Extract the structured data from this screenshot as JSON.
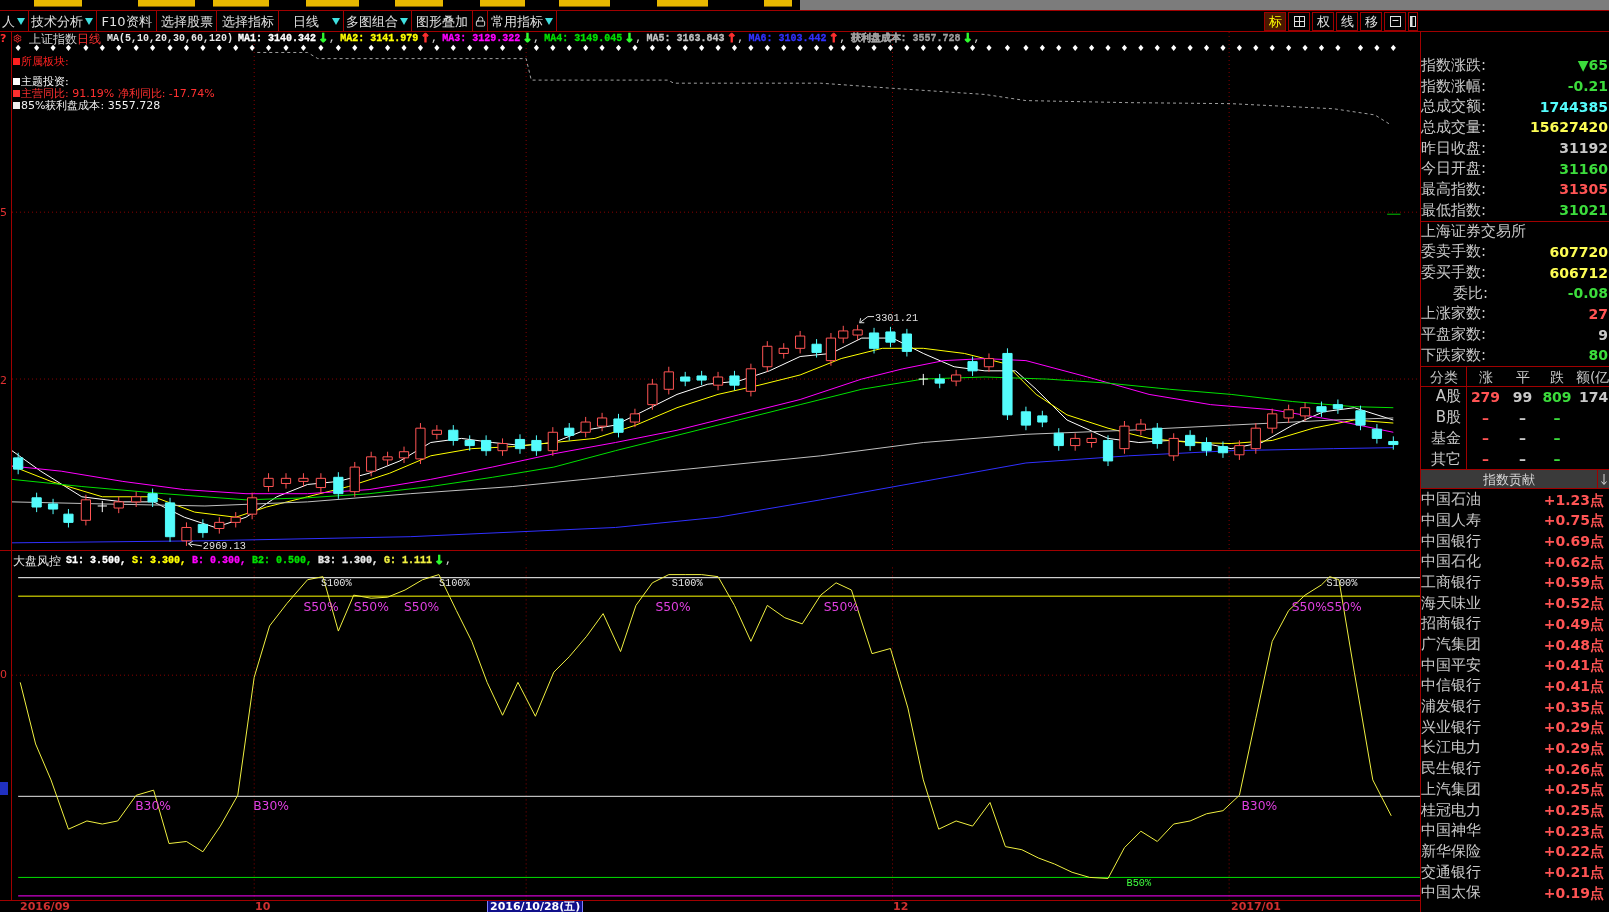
{
  "toolbar": {
    "items": [
      {
        "kind": "dropdown",
        "label": "人"
      },
      {
        "kind": "dropdown",
        "label": "技术分析"
      },
      {
        "kind": "button",
        "label": "F10资料"
      },
      {
        "kind": "button",
        "label": "选择股票"
      },
      {
        "kind": "button",
        "label": "选择指标"
      },
      {
        "kind": "dropdown",
        "label": "日线"
      },
      {
        "kind": "dropdown",
        "label": "多图组合"
      },
      {
        "kind": "button",
        "label": "图形叠加"
      },
      {
        "kind": "lock"
      },
      {
        "kind": "dropdown",
        "label": "常用指标"
      }
    ],
    "view_buttons": [
      {
        "kind": "text",
        "label": "标",
        "selected": true
      },
      {
        "kind": "grid",
        "selected": false
      },
      {
        "kind": "text",
        "label": "权",
        "selected": false
      },
      {
        "kind": "text",
        "label": "线",
        "selected": false
      },
      {
        "kind": "text",
        "label": "移",
        "selected": false
      },
      {
        "kind": "window",
        "selected": false
      },
      {
        "kind": "panel",
        "selected": false
      }
    ]
  },
  "main_chart": {
    "help_mark": "?",
    "title": "上证指数",
    "period": "日线",
    "ma_label": "MA(5,10,20,30,60,120)",
    "readings": [
      {
        "label": "MA1: 3140.342",
        "arrow": {
          "text": "↓",
          "color": "#30ff30"
        },
        "suffix": ",",
        "color": "#ffffff"
      },
      {
        "label": "MA2: 3141.979",
        "arrow": {
          "text": "↑",
          "color": "#ff3030"
        },
        "suffix": ",",
        "color": "#ffff00"
      },
      {
        "label": "MA3: 3129.322",
        "arrow": {
          "text": "↓",
          "color": "#30ff30"
        },
        "suffix": ",",
        "color": "#ff00ff"
      },
      {
        "label": "MA4: 3149.045",
        "arrow": {
          "text": "↓",
          "color": "#30ff30"
        },
        "suffix": ",",
        "color": "#00e000"
      },
      {
        "label": "MA5: 3163.843",
        "arrow": {
          "text": "↑",
          "color": "#ff3030"
        },
        "suffix": ",",
        "color": "#c0c0c0"
      },
      {
        "label": "MA6: 3103.442",
        "arrow": {
          "text": "↑",
          "color": "#ff3030"
        },
        "suffix": ",",
        "color": "#3030ff"
      },
      {
        "label": "获利盘成本: 3557.728",
        "arrow": {
          "text": "↓",
          "color": "#30ff30"
        },
        "suffix": ",",
        "color": "#a0a0a0"
      }
    ],
    "notes": [
      {
        "text": "所属板块:",
        "color": "#ff2020"
      },
      {
        "text": "主题投资:",
        "color": "#ffffff"
      },
      {
        "text": "主营同比: 91.19% 净利同比: -17.74%",
        "color": "#ff3030"
      },
      {
        "text": "85%获利盘成本: 3557.728",
        "color": "#f0f0f0"
      }
    ],
    "axis_labels": [
      "5",
      "2"
    ],
    "high_label": "3301.21",
    "low_label": "2969.13"
  },
  "risk_panel": {
    "name": "大盘风控",
    "params": [
      {
        "label": "S1: 3.500,",
        "color": "#ffffff"
      },
      {
        "label": "S: 3.300,",
        "color": "#ffff00"
      },
      {
        "label": "B: 0.300,",
        "color": "#ff00ff"
      },
      {
        "label": "B2: 0.500,",
        "color": "#00e000"
      },
      {
        "label": "B3: 1.300,",
        "color": "#e8e8e8"
      },
      {
        "label": "G: 1.111",
        "color": "#f0f040",
        "arrow": {
          "text": "↓",
          "color": "#30ff30"
        },
        "suffix": ","
      }
    ],
    "axis_labels": [
      "0"
    ],
    "signals": [
      {
        "text": "S100%",
        "kind": "level"
      },
      {
        "text": "S100%",
        "kind": "level"
      },
      {
        "text": "S100%",
        "kind": "level"
      },
      {
        "text": "S100%",
        "kind": "level"
      },
      {
        "text": "S50%",
        "kind": "signal"
      },
      {
        "text": "S50%",
        "kind": "signal"
      },
      {
        "text": "S50%",
        "kind": "signal"
      },
      {
        "text": "S50%",
        "kind": "signal"
      },
      {
        "text": "S50%",
        "kind": "signal"
      },
      {
        "text": "S50%",
        "kind": "signal"
      },
      {
        "text": "S50%",
        "kind": "signal"
      },
      {
        "text": "B30%",
        "kind": "signal"
      },
      {
        "text": "B30%",
        "kind": "signal"
      },
      {
        "text": "B30%",
        "kind": "signal"
      },
      {
        "text": "B50%",
        "kind": "level"
      }
    ]
  },
  "time_axis": [
    {
      "label": "2016/09",
      "selected": false
    },
    {
      "label": "10",
      "selected": false
    },
    {
      "label": "2016/10/28(五)",
      "selected": true
    },
    {
      "label": "12",
      "selected": false
    },
    {
      "label": "2017/01",
      "selected": false
    }
  ],
  "quote": {
    "rows": [
      {
        "kind": "plain",
        "label": "指数涨跌:",
        "value": "▼65",
        "color": "#3cdc3c"
      },
      {
        "kind": "plain",
        "label": "指数涨幅:",
        "value": "-0.21",
        "color": "#3cdc3c"
      },
      {
        "kind": "plain",
        "label": "总成交额:",
        "value": "1744385",
        "color": "#54fcfc"
      },
      {
        "kind": "plain",
        "label": "总成交量:",
        "value": "15627420",
        "color": "#fcfc54"
      },
      {
        "kind": "plain",
        "label": "昨日收盘:",
        "value": "31192",
        "color": "#c8c8c8"
      },
      {
        "kind": "plain",
        "label": "今日开盘:",
        "value": "31160",
        "color": "#3cdc3c"
      },
      {
        "kind": "plain",
        "label": "最高指数:",
        "value": "31305",
        "color": "#ff5454"
      },
      {
        "kind": "plain",
        "label": "最低指数:",
        "value": "31021",
        "color": "#3cdc3c"
      }
    ]
  },
  "exchange": {
    "title": "上海证券交易所",
    "rows": [
      {
        "kind": "plain",
        "label": "委卖手数:",
        "value": "607720",
        "color": "#fcfc54"
      },
      {
        "kind": "plain",
        "label": "委买手数:",
        "value": "606712",
        "color": "#fcfc54"
      },
      {
        "kind": "indented",
        "label": "委比:",
        "value": "-0.08",
        "color": "#3cdc3c"
      },
      {
        "kind": "plain",
        "label": "上涨家数:",
        "value": "27",
        "color": "#ff5454"
      },
      {
        "kind": "plain",
        "label": "平盘家数:",
        "value": "9",
        "color": "#c8c8c8"
      },
      {
        "kind": "plain",
        "label": "下跌家数:",
        "value": "80",
        "color": "#3cdc3c"
      }
    ]
  },
  "breadth": {
    "columns": [
      "分类",
      "涨",
      "平",
      "跌",
      "额(亿"
    ],
    "rows": [
      {
        "cells": [
          "A股",
          "279",
          "99",
          "809",
          "174"
        ]
      },
      {
        "cells": [
          "B股",
          "–",
          "–",
          "–"
        ]
      },
      {
        "cells": [
          "基金",
          "–",
          "–",
          "–"
        ]
      },
      {
        "cells": [
          "其它",
          "–",
          "–",
          "–"
        ]
      }
    ]
  },
  "contribution": {
    "title": "指数贡献",
    "rows": [
      {
        "name": "中国石油",
        "value": "+1.23点"
      },
      {
        "name": "中国人寿",
        "value": "+0.75点"
      },
      {
        "name": "中国银行",
        "value": "+0.69点"
      },
      {
        "name": "中国石化",
        "value": "+0.62点"
      },
      {
        "name": "工商银行",
        "value": "+0.59点"
      },
      {
        "name": "海天味业",
        "value": "+0.52点"
      },
      {
        "name": "招商银行",
        "value": "+0.49点"
      },
      {
        "name": "广汽集团",
        "value": "+0.48点"
      },
      {
        "name": "中国平安",
        "value": "+0.41点"
      },
      {
        "name": "中信银行",
        "value": "+0.41点"
      },
      {
        "name": "浦发银行",
        "value": "+0.35点"
      },
      {
        "name": "兴业银行",
        "value": "+0.29点"
      },
      {
        "name": "长江电力",
        "value": "+0.29点"
      },
      {
        "name": "民生银行",
        "value": "+0.26点"
      },
      {
        "name": "上汽集团",
        "value": "+0.25点"
      },
      {
        "name": "桂冠电力",
        "value": "+0.25点"
      },
      {
        "name": "中国神华",
        "value": "+0.23点"
      },
      {
        "name": "新华保险",
        "value": "+0.22点"
      },
      {
        "name": "交通银行",
        "value": "+0.21点"
      },
      {
        "name": "中国太保",
        "value": "+0.19点"
      }
    ]
  }
}
